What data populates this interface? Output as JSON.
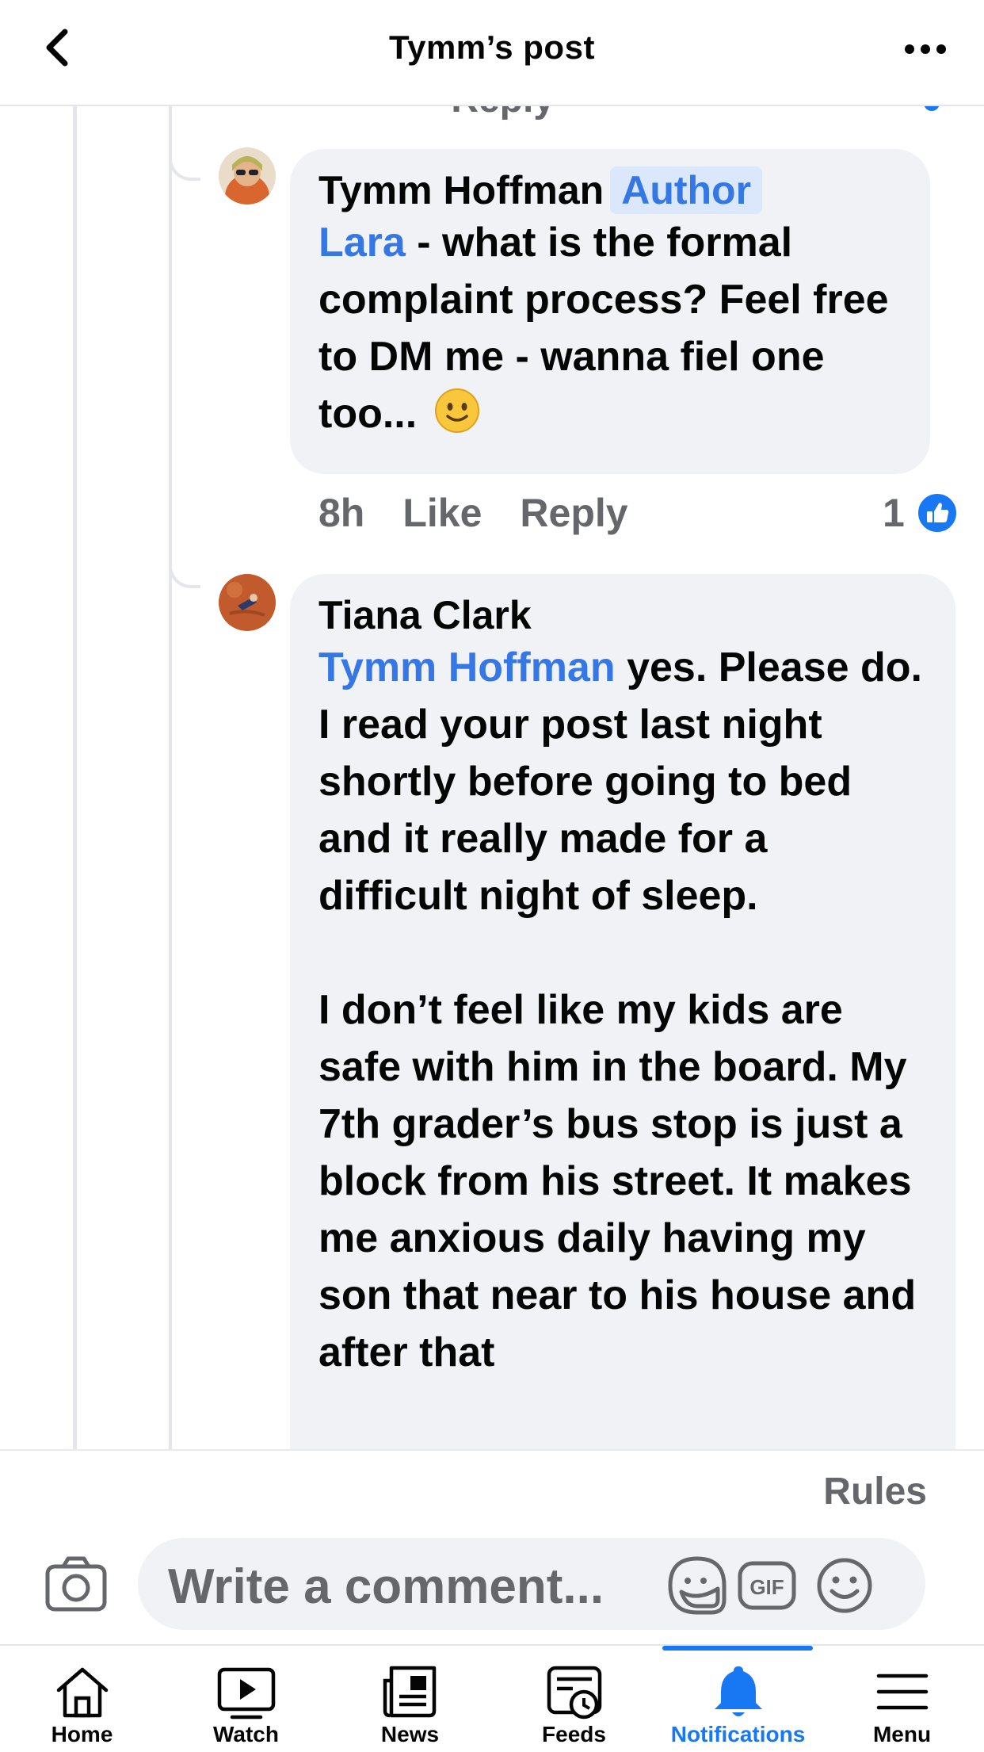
{
  "header": {
    "title": "Tymm’s post"
  },
  "thread": {
    "cut_text": "· Reply",
    "comments": [
      {
        "author": "Tymm Hoffman",
        "badge": "Author",
        "mention": "Lara",
        "text": " - what is the formal complaint process?  Feel free to DM me - wanna fiel one too...",
        "time": "8h",
        "like_label": "Like",
        "reply_label": "Reply",
        "like_count": "1"
      },
      {
        "author": "Tiana Clark",
        "mention": "Tymm Hoffman",
        "text": " yes. Please do. I read your post last night shortly before going to bed and it really made for a difficult night of sleep.\n\nI don’t feel like my kids are safe with him in the board. My 7th grader’s bus stop is just a block from his street. It makes me anxious daily having my son that near to his house and after that"
      }
    ]
  },
  "composer": {
    "rules_label": "Rules",
    "placeholder": "Write a comment..."
  },
  "tabs": [
    {
      "label": "Home",
      "icon": "home-icon"
    },
    {
      "label": "Watch",
      "icon": "watch-icon"
    },
    {
      "label": "News",
      "icon": "news-icon"
    },
    {
      "label": "Feeds",
      "icon": "feeds-icon"
    },
    {
      "label": "Notifications",
      "icon": "bell-icon",
      "active": true
    },
    {
      "label": "Menu",
      "icon": "menu-icon"
    }
  ],
  "colors": {
    "accent": "#1877f2",
    "bubble": "#f0f2f5",
    "secondary_text": "#65676b",
    "mention": "#3578e5"
  }
}
